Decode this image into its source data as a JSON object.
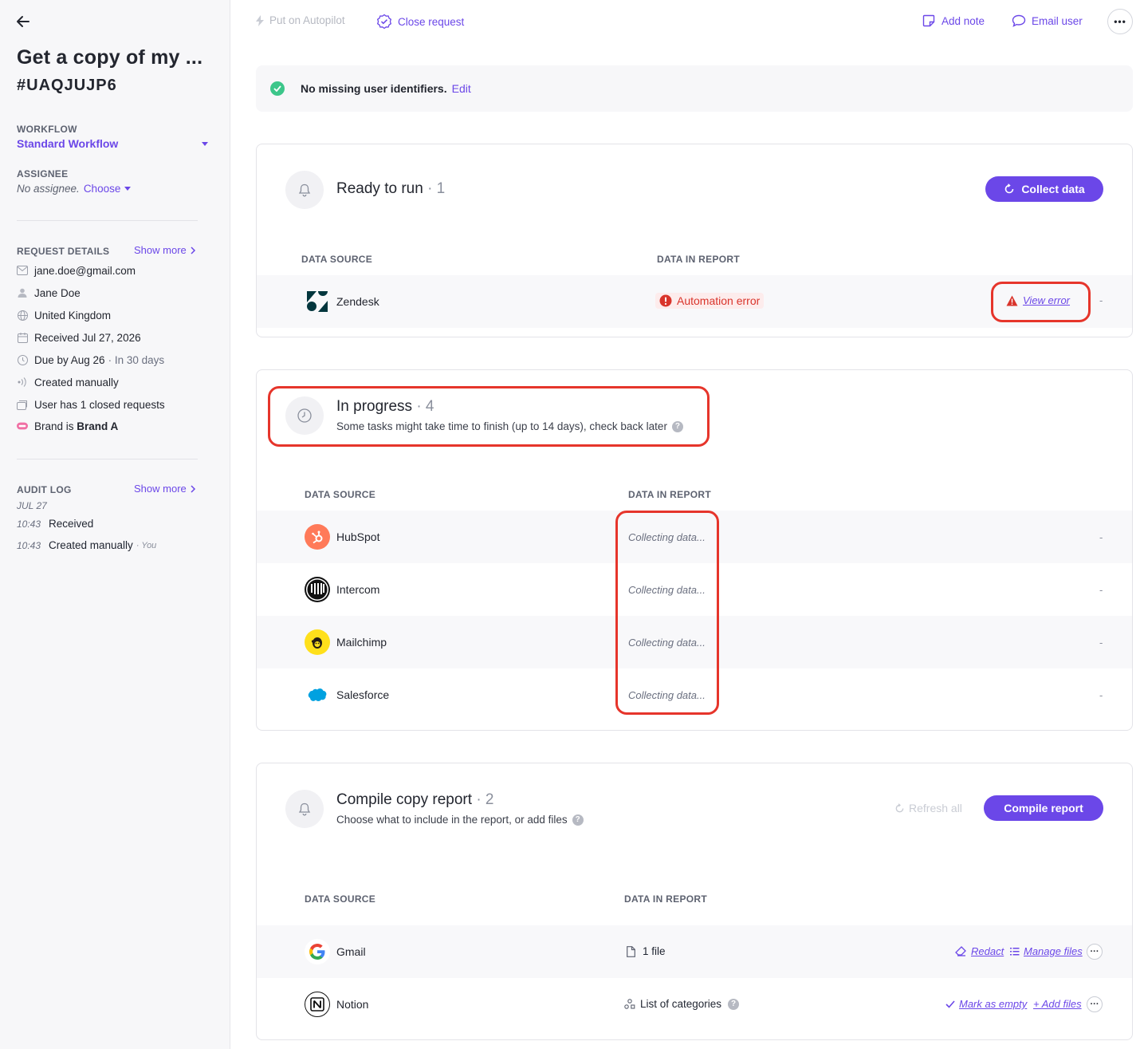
{
  "sidebar": {
    "title": "Get a copy of my ...",
    "request_id": "#UAQJUJP6",
    "workflow": {
      "label": "WORKFLOW",
      "value": "Standard Workflow"
    },
    "assignee": {
      "label": "ASSIGNEE",
      "value": "No assignee.",
      "action": "Choose"
    },
    "request_details": {
      "label": "REQUEST DETAILS",
      "show_more": "Show more",
      "email": "jane.doe@gmail.com",
      "name": "Jane Doe",
      "country": "United Kingdom",
      "received": "Received Jul 27, 2026",
      "due": "Due by Aug 26",
      "due_note": "· In 30 days",
      "created": "Created manually",
      "closed_requests": "User has 1 closed requests",
      "brand_prefix": "Brand is ",
      "brand": "Brand A"
    },
    "audit_log": {
      "label": "AUDIT LOG",
      "show_more": "Show more",
      "date": "JUL 27",
      "entries": [
        {
          "time": "10:43",
          "text": "Received",
          "by": ""
        },
        {
          "time": "10:43",
          "text": "Created manually",
          "by": "· You"
        }
      ]
    }
  },
  "toolbar": {
    "autopilot": "Put on Autopilot",
    "close_request": "Close request",
    "add_note": "Add note",
    "email_user": "Email user",
    "more": "•••"
  },
  "notice": {
    "text": "No missing user identifiers.",
    "action": "Edit"
  },
  "ready": {
    "title": "Ready to run",
    "count": "· 1",
    "button": "Collect data",
    "col_source": "DATA SOURCE",
    "col_report": "DATA IN REPORT",
    "rows": [
      {
        "name": "Zendesk",
        "status": "Automation error",
        "action": "View error",
        "end": "-"
      }
    ]
  },
  "progress": {
    "title": "In progress",
    "count": "· 4",
    "subtitle": "Some tasks might take time to finish (up to 14 days), check back later",
    "col_source": "DATA SOURCE",
    "col_report": "DATA IN REPORT",
    "rows": [
      {
        "name": "HubSpot",
        "status": "Collecting data...",
        "end": "-"
      },
      {
        "name": "Intercom",
        "status": "Collecting data...",
        "end": "-"
      },
      {
        "name": "Mailchimp",
        "status": "Collecting data...",
        "end": "-"
      },
      {
        "name": "Salesforce",
        "status": "Collecting data...",
        "end": "-"
      }
    ]
  },
  "compile": {
    "title": "Compile copy report",
    "count": "· 2",
    "subtitle": "Choose what to include in the report, or add files",
    "refresh": "Refresh all",
    "button": "Compile report",
    "col_source": "DATA SOURCE",
    "col_report": "DATA IN REPORT",
    "rows": [
      {
        "name": "Gmail",
        "report": "1 file",
        "action1": "Redact",
        "action2": "Manage files"
      },
      {
        "name": "Notion",
        "report": "List of categories",
        "action1": "Mark as empty",
        "action2": "+ Add files"
      }
    ]
  },
  "colors": {
    "accent": "#6b47e8",
    "error": "#d9342b",
    "success": "#3cc68a",
    "highlight": "#e6352b"
  }
}
